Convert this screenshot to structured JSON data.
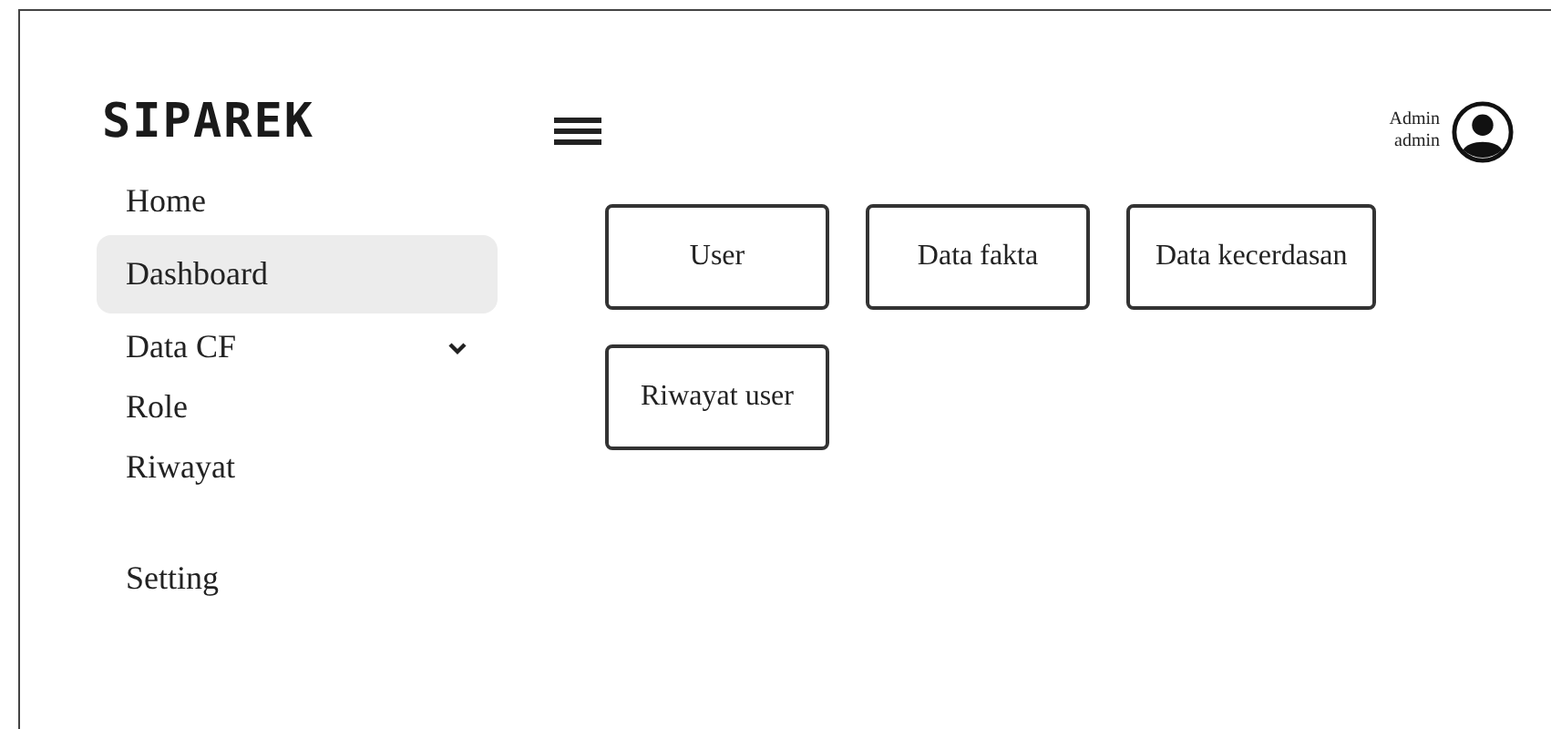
{
  "logo": "SIPAREK",
  "user": {
    "name": "Admin",
    "role": "admin"
  },
  "sidebar": {
    "items": [
      {
        "label": "Home",
        "selected": false
      },
      {
        "label": "Dashboard",
        "selected": true
      },
      {
        "label": "Data CF",
        "selected": false,
        "expanded": false
      },
      {
        "label": "Role",
        "selected": false
      },
      {
        "label": "Riwayat",
        "selected": false
      },
      {
        "label": "Setting",
        "selected": false
      }
    ]
  },
  "cards": [
    "User",
    "Data fakta",
    "Data kecerdasan",
    "Riwayat user"
  ]
}
